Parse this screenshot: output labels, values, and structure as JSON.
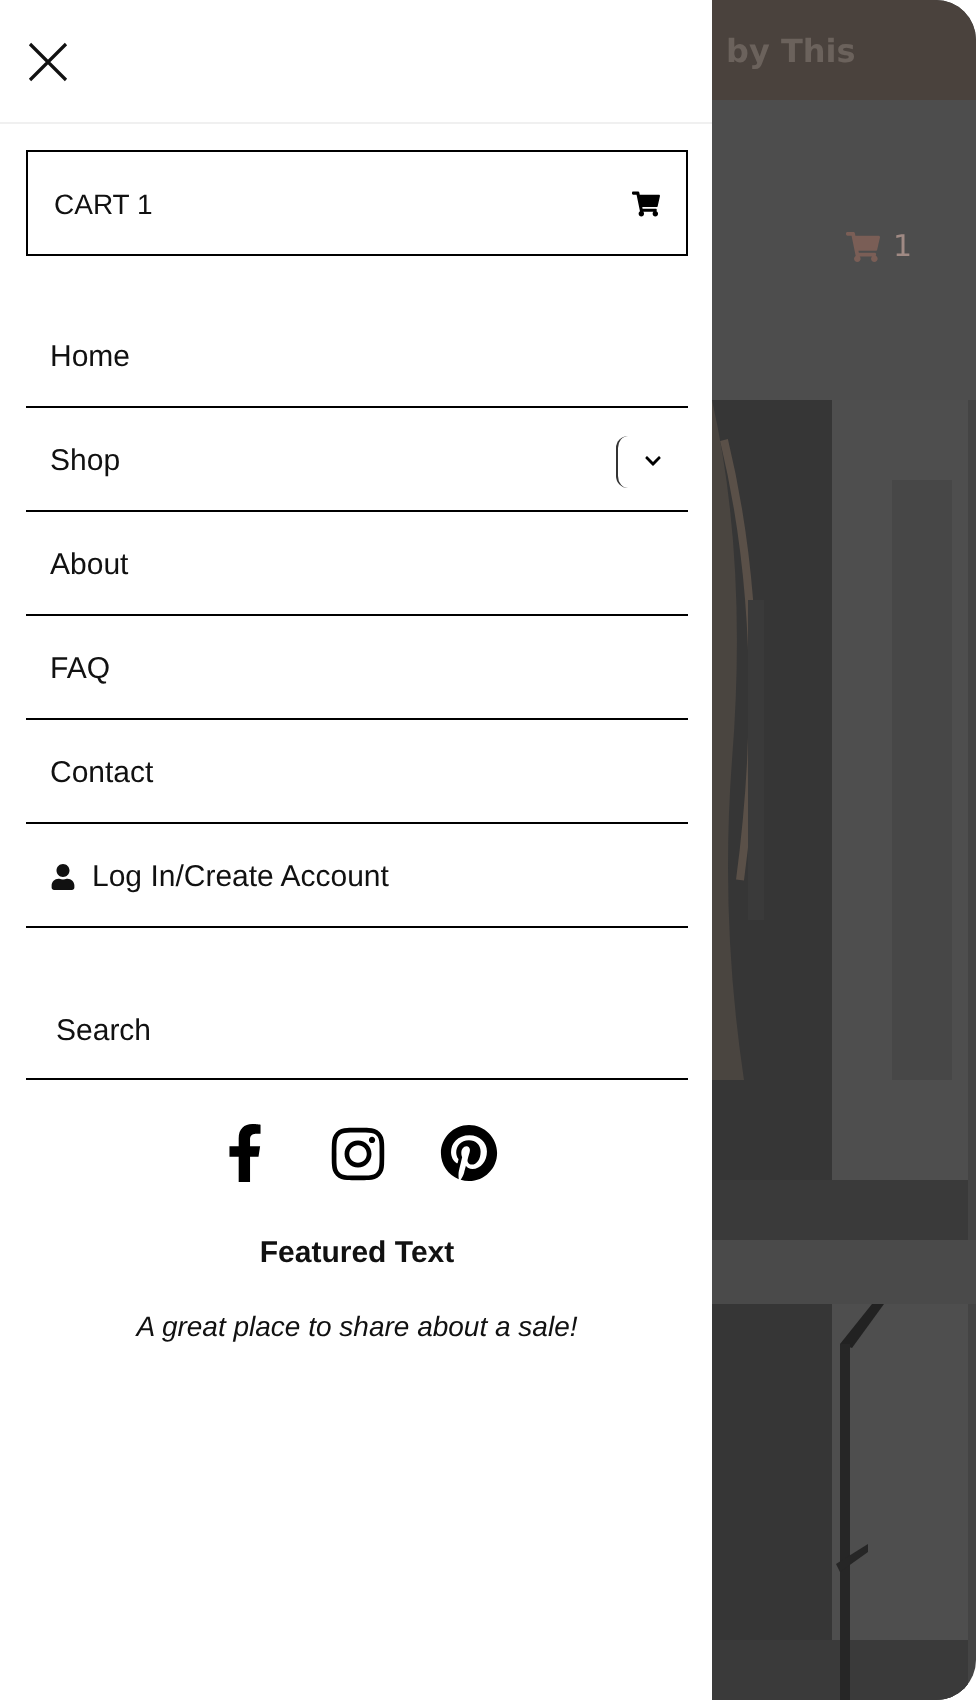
{
  "drawer": {
    "cart": {
      "label": "CART 1"
    },
    "menu": [
      {
        "label": "Home",
        "kind": "link"
      },
      {
        "label": "Shop",
        "kind": "submenu",
        "expanded": false
      },
      {
        "label": "About",
        "kind": "link"
      },
      {
        "label": "FAQ",
        "kind": "link"
      },
      {
        "label": "Contact",
        "kind": "link"
      },
      {
        "label": "Log In/Create Account",
        "kind": "account"
      }
    ],
    "search": {
      "placeholder": "Search"
    },
    "featured": {
      "title": "Featured Text",
      "text": "A great place to share about a sale!"
    }
  },
  "background": {
    "header_text": "by This",
    "cart_count": "1"
  }
}
